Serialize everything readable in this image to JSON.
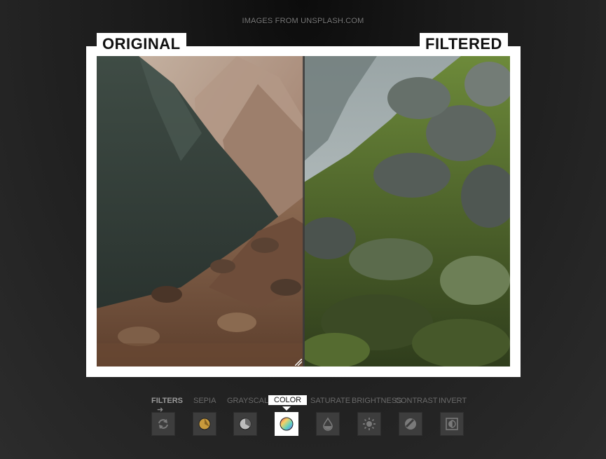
{
  "credit": "IMAGES FROM UNSPLASH.COM",
  "labels": {
    "original": "ORIGINAL",
    "filtered": "FILTERED"
  },
  "toolbar": {
    "filters_label": "FILTERS",
    "tabs": [
      {
        "label": "SEPIA",
        "icon": "sepia-icon"
      },
      {
        "label": "GRAYSCALE",
        "icon": "grayscale-icon"
      },
      {
        "label": "COLOR",
        "icon": "color-icon",
        "active": true
      },
      {
        "label": "SATURATE",
        "icon": "saturate-icon"
      },
      {
        "label": "BRIGHTNESS",
        "icon": "brightness-icon"
      },
      {
        "label": "CONTRAST",
        "icon": "contrast-icon"
      },
      {
        "label": "INVERT",
        "icon": "invert-icon"
      }
    ]
  },
  "colors": {
    "frame": "#ffffff",
    "background_dark": "#0c0c0c",
    "background_light": "#2c2c2c",
    "sepia_swatch": "#c89a3c",
    "active_tab": "#ffffff"
  }
}
